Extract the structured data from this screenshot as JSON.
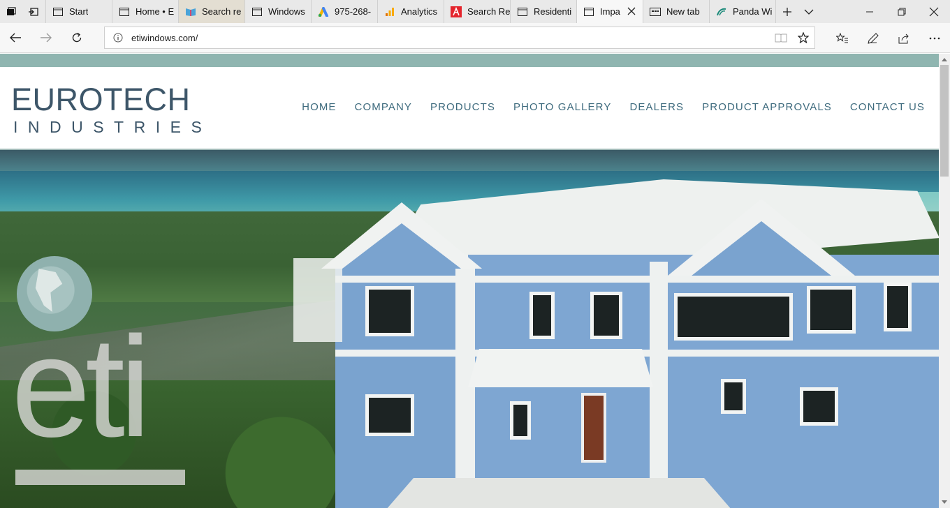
{
  "browser": {
    "tabs": [
      {
        "title": "Start",
        "favicon": "page-icon"
      },
      {
        "title": "Home • E",
        "favicon": "page-icon"
      },
      {
        "title": "Search re",
        "favicon": "book-icon"
      },
      {
        "title": "Windows",
        "favicon": "page-icon"
      },
      {
        "title": "975-268-",
        "favicon": "google-ads-icon"
      },
      {
        "title": "Analytics",
        "favicon": "analytics-icon"
      },
      {
        "title": "Search Re",
        "favicon": "adobe-icon"
      },
      {
        "title": "Residenti",
        "favicon": "page-icon"
      },
      {
        "title": "Impa",
        "favicon": "page-icon",
        "active": true
      },
      {
        "title": "New tab",
        "favicon": "newtab-icon"
      },
      {
        "title": "Panda Wi",
        "favicon": "panda-icon"
      }
    ],
    "url": "etiwindows.com/"
  },
  "site": {
    "brand_line1": "EUROTECH",
    "brand_line2": "INDUSTRIES",
    "nav": [
      "HOME",
      "COMPANY",
      "PRODUCTS",
      "PHOTO GALLERY",
      "DEALERS",
      "PRODUCT APPROVALS",
      "CONTACT US"
    ],
    "hero_mark": "eti",
    "colors": {
      "accent": "#8fb5b0",
      "nav_text": "#3d6a7d",
      "logo": "#3d5669"
    }
  }
}
